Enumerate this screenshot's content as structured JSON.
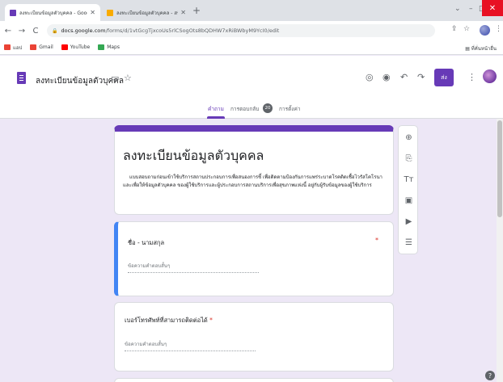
{
  "browser": {
    "tabs": [
      {
        "title": "ลงทะเบียนข้อมูลตัวบุคคล - Google ฟ",
        "close": "✕",
        "favicon_color": "#673ab7"
      },
      {
        "title": "ลงทะเบียนข้อมูลตัวบุคคล - สร้างฟอร์ม",
        "close": "✕",
        "favicon_color": "#f9ab00"
      }
    ],
    "new_tab": "+",
    "window_controls": {
      "chevron": "⌄",
      "minimize": "–",
      "maximize": "□",
      "close": "✕"
    },
    "nav": {
      "back": "←",
      "forward": "→",
      "reload": "C"
    },
    "url_host": "docs.google.com",
    "url_path": "/forms/d/1vtGcgTjxcoUs5rlCSogOts8bQDHW7xRiBWbyM9YcI0/edit",
    "lock": "🔒",
    "share_icon": "⇪",
    "star_icon": "☆",
    "menu_icon": "⋮",
    "bookmarks": [
      {
        "label": "แอป",
        "color": "#ea4335"
      },
      {
        "label": "Gmail",
        "color": "#ea4335"
      },
      {
        "label": "YouTube",
        "color": "#ff0000"
      },
      {
        "label": "Maps",
        "color": "#34a853"
      }
    ],
    "other_bookmarks": "▤ ที่คั่นหน้าอื่น"
  },
  "header": {
    "doc_title": "ลงทะเบียนข้อมูลตัวบุคคล",
    "folder_icon": "▭",
    "star_icon": "☆",
    "palette_icon": "◎",
    "preview_icon": "◉",
    "undo_icon": "↶",
    "redo_icon": "↷",
    "send_label": "ส่ง",
    "more_icon": "⋮",
    "tabs": {
      "questions": "คำถาม",
      "responses": "การตอบกลับ",
      "responses_count": "20",
      "settings": "การตั้งค่า"
    },
    "accent": "#673ab7"
  },
  "form": {
    "title": "ลงทะเบียนข้อมูลตัวบุคคล",
    "description": "แบบสอบถามก่อนเข้าใช้บริการสถานประกอบการเพื่อสนองการชี้ เพื่อติดตามป้องกันการแพร่ระบาดโรคติดเชื้อไวรัสโคโรนาและเพื่อให้ข้อมูลตัวบุคคล ของผู้ใช้บริการและผู้ประกอบการสถานบริการเพื่อสุขภาพแห่งนี้ อยู่กับผู้รับข้อมูลของผู้ใช้บริการ",
    "questions": [
      {
        "title": "ชื่อ - นามสกุล",
        "required_mark": "*",
        "hint": "ข้อความคำตอบสั้นๆ"
      },
      {
        "title": "เบอร์โทรศัพท์ที่สามารถติดต่อได้",
        "required_mark": "*",
        "hint": "ข้อความคำตอบสั้นๆ"
      }
    ]
  },
  "side_toolbar": {
    "add_question": "⊕",
    "import_questions": "⎘",
    "add_title": "Tт",
    "add_image": "▣",
    "add_video": "▶",
    "add_section": "☰"
  },
  "help": "?"
}
